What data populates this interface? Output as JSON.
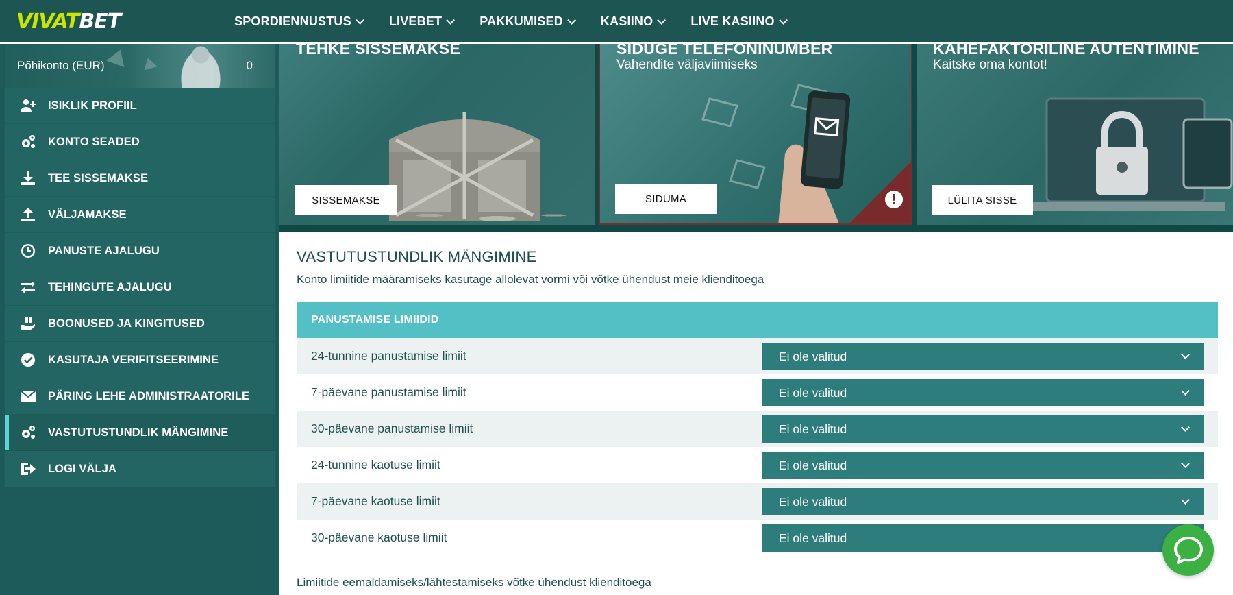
{
  "brand": {
    "logo_a": "VIVAT",
    "logo_b": "BET"
  },
  "nav": {
    "items": [
      {
        "label": "SPORDIENNUSTUS"
      },
      {
        "label": "LIVEBET"
      },
      {
        "label": "PAKKUMISED"
      },
      {
        "label": "KASIINO"
      },
      {
        "label": "LIVE KASIINO"
      }
    ]
  },
  "account": {
    "label": "Põhikonto (EUR)",
    "balance": "0"
  },
  "sidebar": {
    "items": [
      {
        "label": "ISIKLIK PROFIIL",
        "icon": "user-add-icon"
      },
      {
        "label": "KONTO SEADED",
        "icon": "gears-icon"
      },
      {
        "label": "TEE SISSEMAKSE",
        "icon": "download-icon"
      },
      {
        "label": "VÄLJAMAKSE",
        "icon": "upload-icon"
      },
      {
        "label": "PANUSTE AJALUGU",
        "icon": "clock-icon"
      },
      {
        "label": "TEHINGUTE AJALUGU",
        "icon": "swap-arrows-icon"
      },
      {
        "label": "BOONUSED JA KINGITUSED",
        "icon": "gift-hand-icon"
      },
      {
        "label": "KASUTAJA VERIFITSEERIMINE",
        "icon": "check-circle-icon"
      },
      {
        "label": "PÄRING LEHE ADMINISTRAATORILE",
        "icon": "envelope-icon"
      },
      {
        "label": "VASTUTUSTUNDLIK MÄNGIMINE",
        "icon": "gears-icon",
        "active": true
      },
      {
        "label": "LOGI VÄLJA",
        "icon": "logout-icon"
      }
    ]
  },
  "promos": [
    {
      "title": "TEHKE SISSEMAKSE",
      "subtitle": "",
      "button": "SISSEMAKSE"
    },
    {
      "title": "SIDUGE TELEFONINUMBER",
      "subtitle": "Vahendite väljaviimiseks",
      "button": "SIDUMA"
    },
    {
      "title": "KAHEFAKTORILINE AUTENTIMINE",
      "subtitle": "Kaitske oma kontot!",
      "button": "LÜLITA SISSE"
    }
  ],
  "main": {
    "title": "VASTUTUSTUNDLIK MÄNGIMINE",
    "description": "Konto limiitide määramiseks kasutage allolevat vormi või võtke ühendust meie klienditoega",
    "limits_header": "PANUSTAMISE LIMIIDID",
    "limits": [
      {
        "label": "24-tunnine panustamise limiit",
        "value": "Ei ole valitud"
      },
      {
        "label": "7-päevane panustamise limiit",
        "value": "Ei ole valitud"
      },
      {
        "label": "30-päevane panustamise limiit",
        "value": "Ei ole valitud"
      },
      {
        "label": "24-tunnine kaotuse limiit",
        "value": "Ei ole valitud"
      },
      {
        "label": "7-päevane kaotuse limiit",
        "value": "Ei ole valitud"
      },
      {
        "label": "30-päevane kaotuse limiit",
        "value": "Ei ole valitud"
      }
    ],
    "footnote": "Limiitide eemaldamiseks/lähtestamiseks võtke ühendust klienditoega"
  },
  "colors": {
    "accent": "#52c0c4",
    "select_bg": "#2c7d7b",
    "brand_green": "#c8e600",
    "chat_green": "#3cb043"
  }
}
